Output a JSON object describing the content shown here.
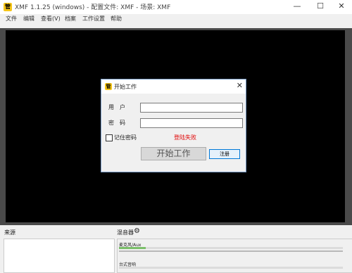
{
  "window": {
    "title": "XMF 1.1.25 (windows) - 配置文件: XMF - 场景: XMF",
    "icon_label": "管",
    "minimize": "—",
    "maximize": "☐",
    "close": "✕"
  },
  "menu": {
    "items": [
      "文件",
      "编辑",
      "查看(V)",
      "档案",
      "工作设置",
      "帮助"
    ]
  },
  "dialog": {
    "title": "开始工作",
    "icon_label": "管",
    "close": "✕",
    "username_label": "用户",
    "username_value": "",
    "password_label": "密码",
    "password_value": "",
    "remember_label": "记住密码",
    "remember_checked": false,
    "error_text": "登陆失败",
    "start_button": "开始工作",
    "register_button": "注册"
  },
  "docks": {
    "source_title": "来源",
    "mixer_title": "混音器",
    "mixer_icon": "gear-icon",
    "mixer_channels": [
      {
        "label": "麦克风/Aux",
        "level": 0.12
      },
      {
        "label": "台式音响",
        "level": 0.0
      }
    ]
  },
  "colors": {
    "preview_bg": "#000000",
    "error": "#e00000",
    "accent": "#0078d7"
  }
}
